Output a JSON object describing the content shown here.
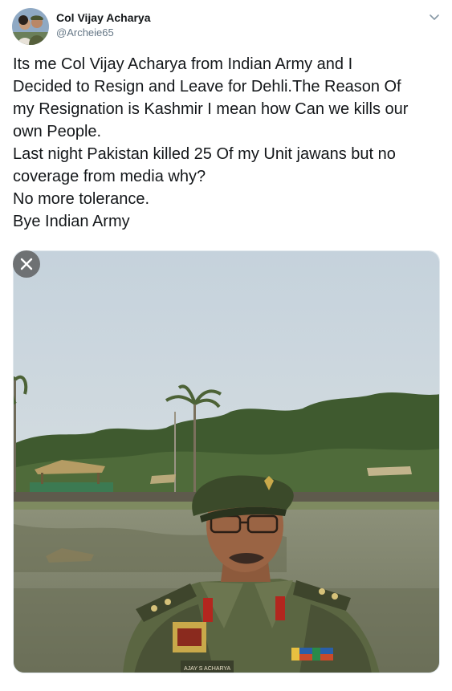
{
  "author": {
    "name": "Col Vijay Acharya",
    "handle": "@Archeie65",
    "avatar_icon": "avatar-photo"
  },
  "tweet": {
    "lines": [
      "Its me Col Vijay Acharya from Indian Army and I",
      "Decided to Resign and Leave for Dehli.The Reason Of",
      "my Resignation is Kashmir I mean how Can we kills our",
      "own People.",
      "Last night Pakistan killed 25 Of my Unit jawans but no",
      "coverage from media why?",
      "No more tolerance.",
      "Bye Indian Army"
    ]
  },
  "media": {
    "nametag": "AJAY S ACHARYA",
    "close_icon": "close-icon",
    "caret_icon": "chevron-down-icon"
  },
  "colors": {
    "text": "#14171a",
    "secondary": "#657786"
  }
}
